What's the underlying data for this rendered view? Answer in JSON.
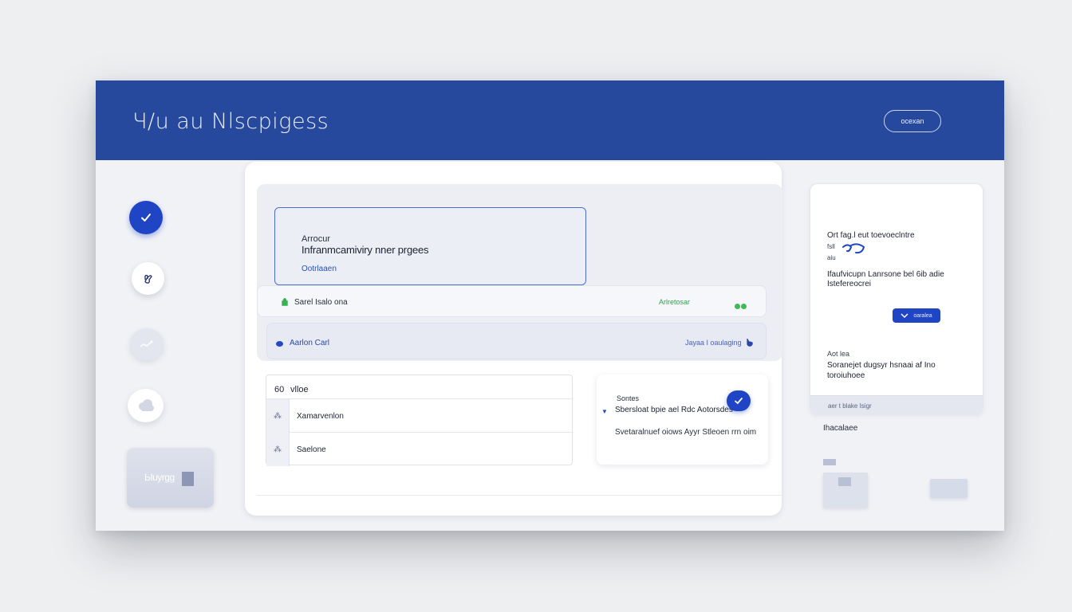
{
  "header": {
    "title": "Ч/u au Nlscpigess",
    "action_label": "ocexan"
  },
  "rail": {
    "items": [
      {
        "icon": "check-icon",
        "active": true
      },
      {
        "icon": "hand-icon",
        "active": false
      },
      {
        "icon": "chart-icon",
        "active": false
      },
      {
        "icon": "cloud-icon",
        "active": false
      }
    ],
    "thumbnail_label": "Ыuyrgg"
  },
  "main": {
    "info_card": {
      "overline": "Arrocur",
      "title": "Infranmcamiviry nner prgees",
      "link": "Ootrlaaen"
    },
    "row_a": {
      "label": "Sarel Isalo ona",
      "status": "Arlretosar"
    },
    "row_b": {
      "label": "Aarlon Carl",
      "meta": "Jayaa I oaulaging"
    },
    "table": {
      "header": [
        "60",
        "vlloe"
      ],
      "rows": [
        {
          "icon": "grid-icon",
          "label": "Xamarvenlon"
        },
        {
          "icon": "grid-icon",
          "label": "Saelone"
        }
      ]
    },
    "task": {
      "overline": "Sontes",
      "title": "Sbersloat bpie ael Rdc Aotorsdes",
      "description": "Svetaralnuef oiows Ayyr Stleoen rrn oim"
    }
  },
  "side_panel": {
    "line1": "Ort fag.l eut toevoeclntre",
    "small1": "fsll",
    "small2": "aiu",
    "para1": "Ifaufvicupn Lanrsone bel 6ib adie Istefereocrei",
    "button_label": "oaralea",
    "overline2": "Aot lea",
    "para2": "Soranejet dugsyr hsnaai af Ino toroiuhoee",
    "footer_label": "aer t blake Isigr",
    "below_label": "Ihacalaee"
  },
  "colors": {
    "header_bg": "#26499e",
    "accent": "#1f45c4",
    "status_green": "#3dbb55",
    "page_bg": "#eeeff1"
  }
}
